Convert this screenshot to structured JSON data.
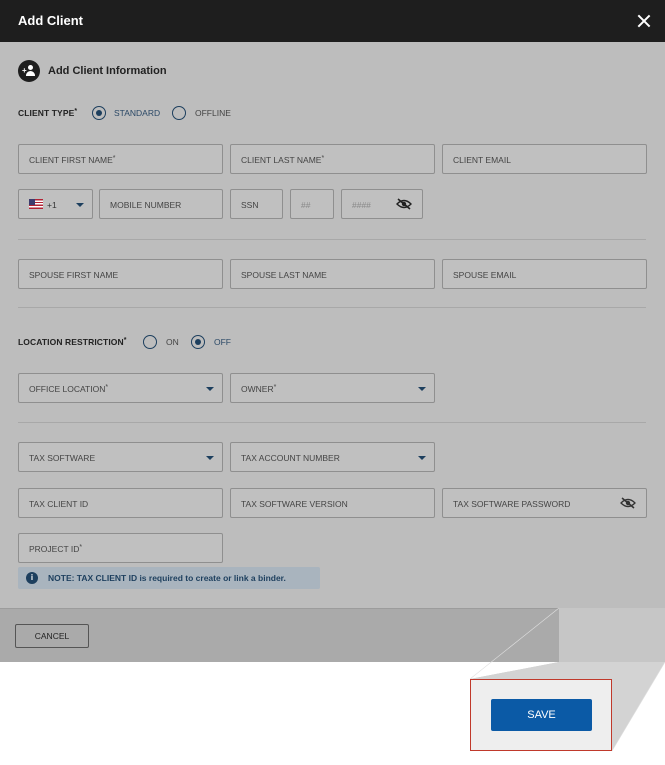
{
  "dialog": {
    "title": "Add Client"
  },
  "section": {
    "title": "Add Client Information"
  },
  "client_type": {
    "label": "CLIENT TYPE",
    "required_mark": "*",
    "options": [
      {
        "label": "STANDARD",
        "selected": true
      },
      {
        "label": "OFFLINE",
        "selected": false
      }
    ]
  },
  "fields": {
    "client_first_name": "CLIENT FIRST NAME",
    "client_last_name": "CLIENT LAST NAME",
    "client_email": "CLIENT EMAIL",
    "phone_code": "+1",
    "mobile_number": "MOBILE NUMBER",
    "ssn": "SSN",
    "ssn_part2": "##",
    "ssn_part3": "####",
    "spouse_first_name": "SPOUSE FIRST NAME",
    "spouse_last_name": "SPOUSE LAST NAME",
    "spouse_email": "SPOUSE EMAIL",
    "office_location": "OFFICE LOCATION",
    "owner": "OWNER",
    "tax_software": "TAX SOFTWARE",
    "tax_account_number": "TAX ACCOUNT NUMBER",
    "tax_client_id": "TAX CLIENT ID",
    "tax_software_version": "TAX SOFTWARE VERSION",
    "tax_software_password": "TAX SOFTWARE PASSWORD",
    "project_id": "PROJECT ID",
    "required_mark": "*"
  },
  "location_restriction": {
    "label": "LOCATION RESTRICTION",
    "required_mark": "*",
    "options": [
      {
        "label": "ON",
        "selected": false
      },
      {
        "label": "OFF",
        "selected": true
      }
    ]
  },
  "note": {
    "text": "NOTE: TAX CLIENT ID is required to create or link a binder."
  },
  "footer": {
    "cancel_label": "CANCEL",
    "save_label": "SAVE"
  },
  "zoom": {
    "save_label": "SAVE"
  },
  "colors": {
    "primary": "#0b5aa6",
    "accent": "#1d3f5e",
    "titlebar": "#1e1e1e"
  }
}
